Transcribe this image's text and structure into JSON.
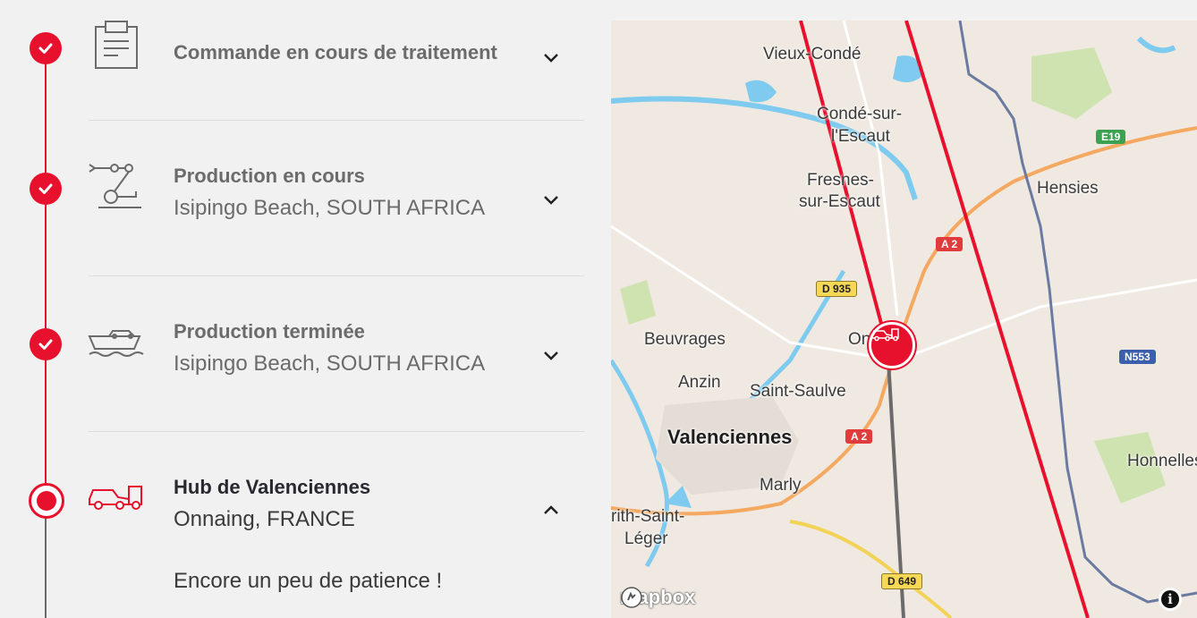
{
  "timeline": {
    "steps": [
      {
        "title": "Commande en cours de traitement",
        "subtitle": "",
        "status": "done",
        "icon": "clipboard-icon",
        "expanded": false
      },
      {
        "title": "Production en cours",
        "subtitle": "Isipingo Beach, SOUTH AFRICA",
        "status": "done",
        "icon": "robot-arm-icon",
        "expanded": false
      },
      {
        "title": "Production terminée",
        "subtitle": "Isipingo Beach, SOUTH AFRICA",
        "status": "done",
        "icon": "car-ship-icon",
        "expanded": false
      },
      {
        "title": "Hub de Valenciennes",
        "subtitle": "Onnaing, FRANCE",
        "status": "current",
        "icon": "car-truck-icon",
        "expanded": true,
        "message": "Encore un peu de patience !"
      }
    ]
  },
  "map": {
    "labels": {
      "vieux_conde": "Vieux-Condé",
      "conde_1": "Condé-sur-",
      "conde_2": "l'Escaut",
      "fresnes_1": "Fresnes-",
      "fresnes_2": "sur-Escaut",
      "hensies": "Hensies",
      "beuvrages": "Beuvrages",
      "onnaing": "Onnaing",
      "anzin": "Anzin",
      "saint_saulve": "Saint-Saulve",
      "valenciennes": "Valenciennes",
      "marly": "Marly",
      "honnelles": "Honnelles",
      "trith_1": "rith-Saint-",
      "trith_2": "Léger"
    },
    "shields": {
      "e19": "E19",
      "a2_top": "A 2",
      "d935": "D 935",
      "n553": "N553",
      "a2_bottom": "A 2",
      "d649": "D 649"
    },
    "attribution": "mapbox",
    "info": "i",
    "colors": {
      "route": "#e8112d",
      "current_route": "#6b6b6b",
      "water": "#7ecbef",
      "road_major": "#f4a860",
      "border": "#6b7aa0"
    }
  }
}
